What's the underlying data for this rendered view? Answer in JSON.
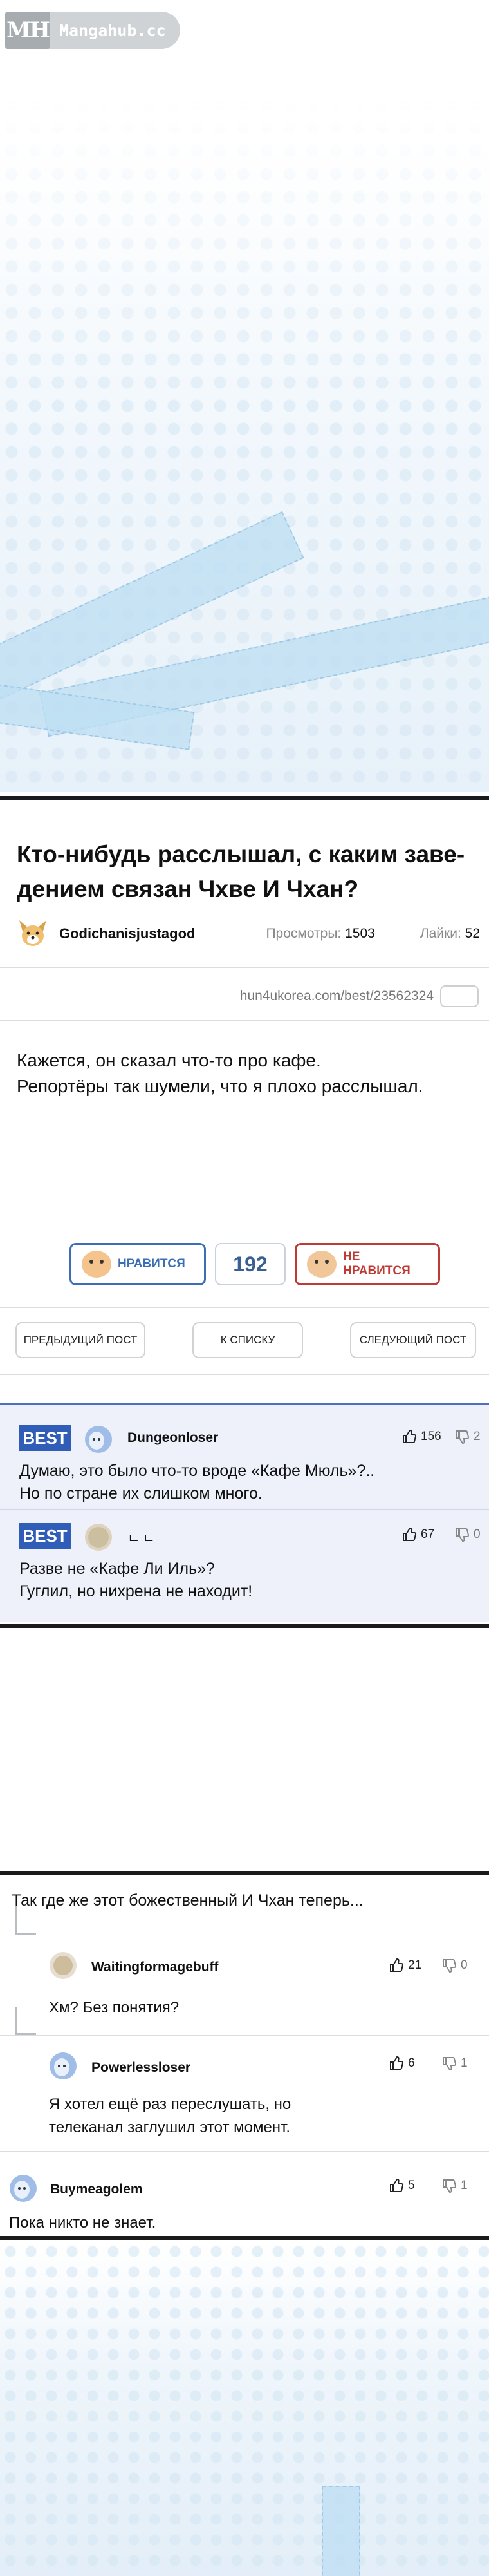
{
  "watermark": {
    "logo": "MH",
    "site": "Mangahub.cc"
  },
  "post": {
    "title": "Кто-нибудь расслышал, с каким заве-дением связан Чхве И Чхан?",
    "author": "Godichanisjustagod",
    "views_label": "Просмотры:",
    "views": "1503",
    "likes_label": "Лайки:",
    "likes": "52",
    "url": "hun4ukorea.com/best/23562324",
    "body_line1": "Кажется, он сказал что-то про кафе.",
    "body_line2": "Репортёры так шумели, что я плохо расслышал.",
    "like_label": "НРАВИТСЯ",
    "vote_count": "192",
    "dislike_label": "НЕ НРАВИТСЯ"
  },
  "nav": {
    "prev": "ПРЕДЫДУЩИЙ ПОСТ",
    "list": "К СПИСКУ",
    "next": "СЛЕДУЮЩИЙ ПОСТ"
  },
  "best_comments": [
    {
      "badge": "BEST",
      "author": "Dungeonloser",
      "likes": "156",
      "dislikes": "2",
      "line1": "Думаю, это было что-то вроде «Кафе Мюль»?..",
      "line2": "Но по стране их слишком много."
    },
    {
      "badge": "BEST",
      "author": "ㄴㄴ",
      "likes": "67",
      "dislikes": "0",
      "line1": "Разве не «Кафе Ли Иль»?",
      "line2": "Гуглил, но нихрена не находит!"
    }
  ],
  "lower": {
    "question": "Так где же этот божественный И Чхан теперь...",
    "replies": [
      {
        "author": "Waitingformagebuff",
        "likes": "21",
        "dislikes": "0",
        "line1": "Хм? Без понятия?",
        "line2": ""
      },
      {
        "author": "Powerlessloser",
        "likes": "6",
        "dislikes": "1",
        "line1": "Я хотел ещё раз переслушать, но",
        "line2": "телеканал заглушил этот момент."
      }
    ],
    "root": {
      "author": "Buymeagolem",
      "likes": "5",
      "dislikes": "1",
      "line1": "Пока никто не знает."
    }
  },
  "colors": {
    "accent": "#2f5db8",
    "dislike": "#c03a34",
    "panel_border": "#1b1b1b"
  },
  "icons": [
    "thumbs-up-icon",
    "thumbs-down-icon",
    "reply-arrow-icon",
    "dog-avatar-icon",
    "ghost-avatar-icon"
  ]
}
